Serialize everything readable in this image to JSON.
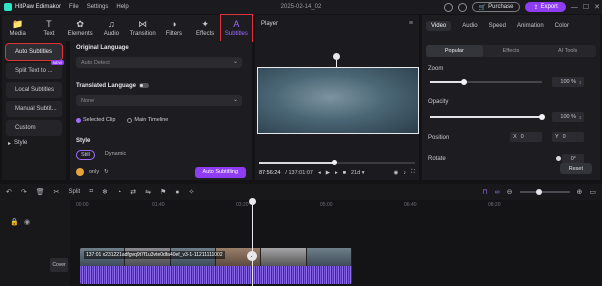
{
  "titlebar": {
    "app_name": "HitPaw Edimakor",
    "menus": [
      "File",
      "Settings",
      "Help"
    ],
    "date": "2025-02-14_02",
    "purchase_label": "Purchase",
    "export_label": "Export",
    "minimize": "—",
    "maximize": "☐",
    "close": "✕"
  },
  "toolbar_tabs": [
    {
      "label": "Media",
      "icon": "📁"
    },
    {
      "label": "Text",
      "icon": "T"
    },
    {
      "label": "Elements",
      "icon": "✿"
    },
    {
      "label": "Audio",
      "icon": "♫"
    },
    {
      "label": "Transition",
      "icon": "⋈"
    },
    {
      "label": "Filters",
      "icon": "◑"
    },
    {
      "label": "Effects",
      "icon": "✦"
    },
    {
      "label": "Subtitles",
      "icon": "A"
    }
  ],
  "sidebar": {
    "items": [
      {
        "label": "Auto Subtitles"
      },
      {
        "label": "Split Text to ...",
        "badge": "NEW"
      },
      {
        "label": "Local Subtitles"
      },
      {
        "label": "Manual Subtit..."
      },
      {
        "label": "Custom"
      }
    ],
    "style_label": "Style"
  },
  "subtitle_options": {
    "original_language_title": "Original Language",
    "original_language_value": "Auto Detect",
    "translated_language_title": "Translated Language",
    "translated_language_value": "None",
    "scope_options": [
      "Selected Clip",
      "Main Timeline"
    ],
    "style_title": "Style",
    "style_options": [
      "Still",
      "Dynamic"
    ],
    "credit_label": "only",
    "auto_button": "Auto Subtitling"
  },
  "player": {
    "title": "Player",
    "current_time": "87:56:24",
    "total_time": "/ 137:01:07",
    "speed": "21d ▾",
    "progress": 0.48
  },
  "properties": {
    "tabs": [
      "Video",
      "Audio",
      "Speed",
      "Animation",
      "Color"
    ],
    "subtabs": [
      "Popular",
      "Effects",
      "AI Tools"
    ],
    "zoom_label": "Zoom",
    "zoom_value": "100 %",
    "zoom_level": 0.3,
    "opacity_label": "Opacity",
    "opacity_value": "100 %",
    "opacity_level": 1.0,
    "position_label": "Position",
    "pos_x_label": "X",
    "pos_x_value": "0",
    "pos_y_label": "Y",
    "pos_y_value": "0",
    "rotate_label": "Rotate",
    "rotate_value": "0°",
    "reset_label": "Reset"
  },
  "timeline": {
    "split_label": "Split",
    "ruler": [
      "00:00",
      "01:40",
      "03:20",
      "05:00",
      "06:40",
      "08:20"
    ],
    "cover_label": "Cover",
    "clip_label": "137:01 x231221adfgvq9t7f1u3vte0dfa40ef_v3-1-11211111002"
  },
  "colors": {
    "accent": "#8e3df2",
    "highlight_border": "#e0323a",
    "active_tab_text": "#9f6cff"
  }
}
